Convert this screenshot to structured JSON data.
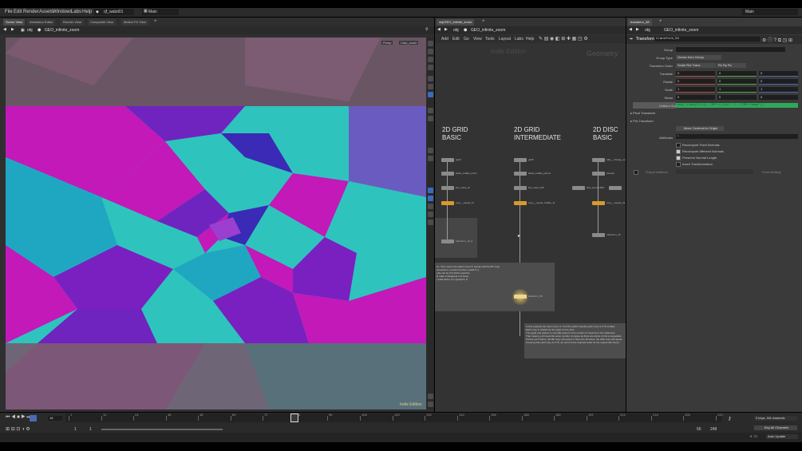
{
  "menu": [
    "File",
    "Edit",
    "Render",
    "Assets",
    "Windows",
    "Labs",
    "Help"
  ],
  "scene_file": "rjf_wabd01",
  "desktop": "Main",
  "desktop_right": "Main",
  "left_tabs": [
    "Scene View",
    "Animation Editor",
    "Render View",
    "Composite View",
    "Motion FX View"
  ],
  "left_path": {
    "root": "obj",
    "node": "GEO_infinite_zoom"
  },
  "viewport": {
    "persp": "Persp",
    "cam": "Cam_zoom",
    "edition": "Indie Edition"
  },
  "mid_tab": "obj/GEO_infinite_zoom",
  "mid_path": {
    "root": "obj",
    "node": "GEO_infinite_zoom"
  },
  "net_menu": [
    "Add",
    "Edit",
    "Go",
    "View",
    "Tools",
    "Layout",
    "Labs",
    "Help"
  ],
  "net_watermark": {
    "edition": "Indie Edition",
    "context": "Geometry"
  },
  "sections": [
    {
      "line1": "2D GRID",
      "line2": "BASIC"
    },
    {
      "line1": "2D GRID",
      "line2": "INTERMEDIATE"
    },
    {
      "line1": "2D DISC",
      "line2": "BASIC"
    }
  ],
  "nodes": {
    "c1": [
      "grid4",
      "black_middle_prims",
      "line_seed_12",
      "copy__repeat_11",
      "transform_13_3"
    ],
    "c2": [
      "grid5",
      "black_middle_prims1",
      "line_seed_120",
      "copy__repeat_middle_11",
      "transform_58"
    ],
    "c3": [
      "tube__change_se",
      "foreach",
      "disc_seed_1000",
      "copy__repeat_14",
      "transform_15"
    ]
  },
  "sticky1": [
    "un. This means the pattern doesn't repeat until the 8th copy.",
    "",
    "xpressed in a power function pow(0.5, t)",
    "cale can be 0.5 which would be",
    "ill make it disappear in 8 steps",
    "t scale factor at 1 (pow(0.5, 8"
  ],
  "sticky2": [
    "In this example the outer ring is 1 / 8 of the width meaning each copy is 0.75 smaller.",
    "Each copy is rotated by the angle of one slice.",
    "The angle and pattern is normally based on the number of columns in the initial tube.",
    "That means you'll need the same number of copies as there are slices to find a repeatable",
    "If there are 8 slices, the 8th copy will repeat. If there are 20 slices, the 20th copy will repeat.",
    "Knowing that each copy is 0.75, we can find the required scale for the repeat with 1/pow."
  ],
  "params": {
    "header_tab": "transform_58",
    "type_label": "Transform",
    "node_name": "transform_58",
    "group_label": "Group",
    "group_value": "",
    "group_type_label": "Group Type",
    "group_type_value": "Guess from Group",
    "transform_order_label": "Transform Order",
    "transform_order_value": "Scale Rot Trans",
    "rot_order_value": "Rx Ry Rz",
    "translate_label": "Translate",
    "translate": [
      "0",
      "0",
      "0"
    ],
    "rotate_label": "Rotate",
    "rotate": [
      "0",
      "0",
      "0"
    ],
    "scale_label": "Scale",
    "scale": [
      "1",
      "1",
      "1"
    ],
    "shear_label": "Shear",
    "shear": [
      "0",
      "0",
      "0"
    ],
    "uniform_scale_label": "Uniform Scale",
    "uniform_scale_expr": "pow( 1/pow(0.5,4) ,($FF-1)/ch(\"../../CTRL/range\"))",
    "pivot_transform": "Pivot Transform",
    "pre_transform": "Pre-Transform",
    "move_centroid": "Move Centroid to Origin",
    "attributes_label": "Attributes",
    "attributes_value": "*",
    "checks": [
      {
        "label": "Recompute Point Normals",
        "on": false
      },
      {
        "label": "Recompute Affected Normals",
        "on": true
      },
      {
        "label": "Preserve Normal Length",
        "on": true
      },
      {
        "label": "Invert Transformation",
        "on": false
      }
    ],
    "output_attrib_label": "Output Attribute",
    "point_multiply_label": "Point Multiply"
  },
  "timeline": {
    "current_frame": "18",
    "start": "1",
    "start2": "1",
    "end": "56",
    "end2": "248",
    "ticks": [
      "1",
      "12",
      "24",
      "36",
      "48",
      "60",
      "72",
      "84",
      "96",
      "108",
      "120",
      "132",
      "144",
      "156",
      "168",
      "180",
      "192",
      "204",
      "216",
      "228",
      "240"
    ],
    "keys_info": "0 keys, 0/6 channels",
    "key_all": "Key All Channels",
    "auto_update": "Auto Update"
  },
  "colors": {
    "magenta": "#c219b8",
    "purple": "#6f24c0",
    "teal": "#2ec4bd",
    "cyan": "#1fa7c2",
    "violet": "#3a2ab6",
    "orange": "#d89a2c"
  }
}
